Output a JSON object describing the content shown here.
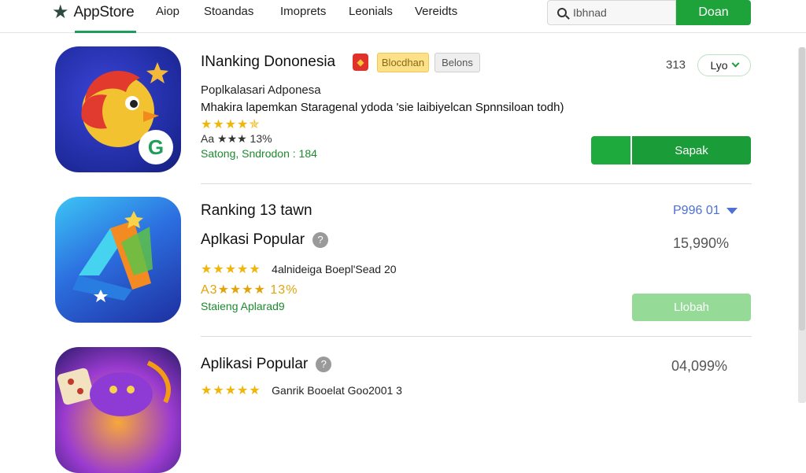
{
  "header": {
    "app_title": "AppStore",
    "nav": [
      "Aiop",
      "Stoandas",
      "Imoprets",
      "Leonials",
      "Vereidts"
    ],
    "search_value": "Ibhnad",
    "search_button": "Doan"
  },
  "apps": [
    {
      "title": "INanking Dononesia",
      "badge_yellow": "Blocdhan",
      "badge_grey": "Belons",
      "count": "313",
      "select_value": "Lyo",
      "subtitle": "Poplkalasari Adponesa",
      "description": "Mhakira lapemkan Staragenal ydoda 'sie laibiyelcan Spnnsiloan todh)",
      "stars": "★★★★✯",
      "rating_line": "Aa ★★★ 13%",
      "green_line": "Satong, Sndrodon : 184",
      "button": "Sapak"
    },
    {
      "title": "Ranking 13 tawn",
      "subtitle": "Aplkasi Popular",
      "price": "P996 01",
      "percent": "15,990%",
      "stars": "★★★★★",
      "stars_note": "4alnideiga Boepl'Sead 20",
      "rating_line": "A3★★★★ 13%",
      "green_line": "Staieng Aplarad9",
      "button": "Llobah"
    },
    {
      "title": "Aplikasi Popular",
      "percent": "04,099%",
      "stars": "★★★★★",
      "stars_note": "Ganrik Booelat Goo2001 3"
    }
  ],
  "colors": {
    "accent_green": "#1ea33a",
    "price_blue": "#4d6fd6",
    "star_gold": "#f1b60b"
  }
}
